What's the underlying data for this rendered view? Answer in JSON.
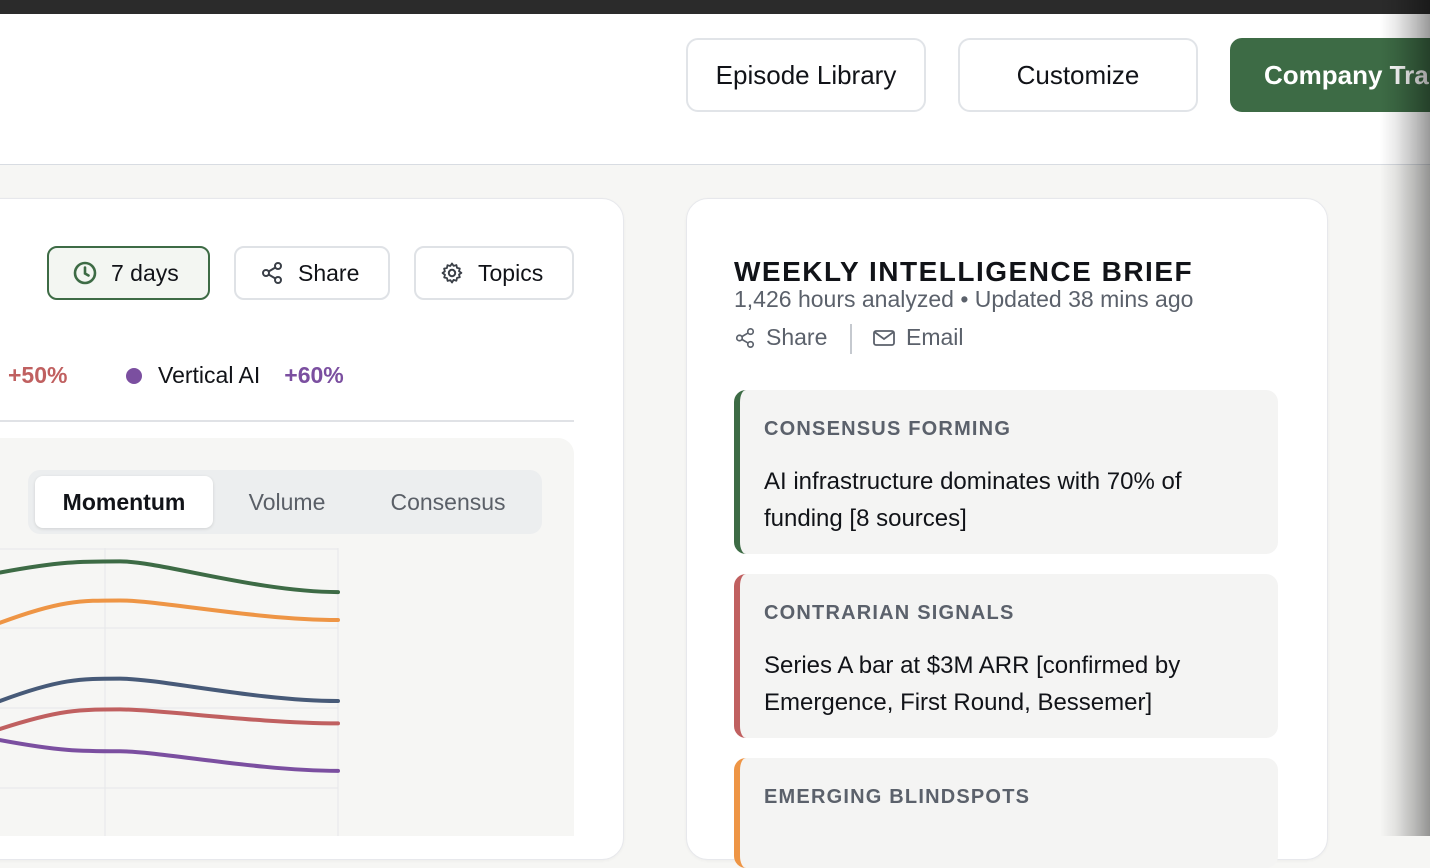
{
  "header": {
    "episode_library": "Episode Library",
    "customize": "Customize",
    "company_tracker": "Company Tra"
  },
  "controls": {
    "days": "7 days",
    "share": "Share",
    "topics": "Topics"
  },
  "legend": [
    {
      "label": "",
      "change": "+50%",
      "color": "#c06060"
    },
    {
      "label": "Vertical AI",
      "change": "+60%",
      "color": "#7b4fa0"
    }
  ],
  "chart_tabs": [
    "Momentum",
    "Volume",
    "Consensus"
  ],
  "chart_data": {
    "type": "line",
    "series": [
      {
        "color": "#3d6b45",
        "values": [
          0.8,
          0.84,
          0.73
        ]
      },
      {
        "color": "#ee9545",
        "values": [
          0.62,
          0.7,
          0.63
        ]
      },
      {
        "color": "#475a78",
        "values": [
          0.34,
          0.42,
          0.34
        ]
      },
      {
        "color": "#c06060",
        "values": [
          0.24,
          0.31,
          0.26
        ]
      },
      {
        "color": "#7b4fa0",
        "values": [
          0.2,
          0.16,
          0.09
        ]
      }
    ]
  },
  "brief": {
    "title": "WEEKLY INTELLIGENCE BRIEF",
    "meta": "1,426 hours analyzed • Updated 38 mins ago",
    "share": "Share",
    "email": "Email",
    "signals": [
      {
        "label": "CONSENSUS FORMING",
        "text": "AI infrastructure dominates with 70% of funding [8 sources]",
        "color": "#3d6b45"
      },
      {
        "label": "CONTRARIAN SIGNALS",
        "text": "Series A bar at $3M ARR [confirmed by Emergence, First Round, Bessemer]",
        "color": "#c06060"
      },
      {
        "label": "EMERGING BLINDSPOTS",
        "text": "",
        "color": "#ee9545"
      }
    ]
  }
}
